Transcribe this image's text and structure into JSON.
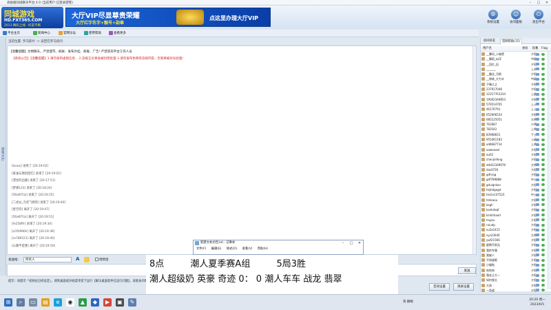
{
  "window": {
    "title": "高级版同城聊天平台 4.0 (当前用户:已登录游客)"
  },
  "banner": {
    "logo_title": "同城游戏",
    "logo_domain": "HD.FXT365.COM",
    "logo_slogan": "2013 精彩上线 · 好友不断",
    "ad_title": "大厅VIP尽显尊贵荣耀",
    "ad_sub": "大厅红字名字+靓号+勋章",
    "ad_action": "点这里办理大厅VIP"
  },
  "top_buttons": [
    {
      "label": "系统设置",
      "icon": "gear-icon"
    },
    {
      "label": "访问面板",
      "icon": "person-icon"
    },
    {
      "label": "退出平台",
      "icon": "exit-icon"
    }
  ],
  "toolbar": [
    {
      "label": "平台主页",
      "icon": "home-icon",
      "color": "#3b79c9"
    },
    {
      "label": "新闻中心",
      "icon": "news-icon",
      "color": "#4caf50"
    },
    {
      "label": "官网论坛",
      "icon": "forum-icon",
      "color": "#e6a23c"
    },
    {
      "label": "使用帮助",
      "icon": "help-icon",
      "color": "#2aa5a0"
    },
    {
      "label": "查看更多",
      "icon": "more-icon",
      "color": "#9b59b6"
    }
  ],
  "breadcrumb": "当前位置: 罗马影片 -> 返回在罗马房间",
  "side_tab": "游戏大厅",
  "notice": "【温馨提醒】文明聊天，严禁谩骂、刷屏、发布外挂、病毒、广告! 严禁冒充平台工作人员",
  "system_message": "【系统公告】【温馨提醒】1.请勿发布虚假信息... 2.违规言论将会被封禁处理 3.请勿发布色情等违规内容，否则将被封号处理!",
  "chat_lines": [
    "[koiuo] 进来了 [20:19:02]",
    "[爱油与我的回忆] 进来了 [20:19:02]",
    "[漂亮的出路] 进来了 [20:17:51]",
    "[梦想123] 进来了 [20:18:24]",
    "[56a6f7zz] 进来了 [20:19:25]",
    "[二虎伙_鸟老飞爬的] 进来了 [20:19:40]",
    "[星空的] 离开了 [20:19:47]",
    "[56a6f7zz] 离开了 [20:19:51]",
    "[fe258ffr] 进来了 [20:19:34]",
    "[a76t990h] 离开了 [20:19:39]",
    "[ss786521] 离开了 [20:19:40]",
    "[以路不是我] 离开了 [20:19:50]"
  ],
  "input": {
    "send_to_label": "发送给:",
    "send_to_value": "所有人",
    "private_label": "悄悄话",
    "send_button": "发送"
  },
  "bottom_tip": "提示：如提示「初始化已经设定」，请到桌面或开始菜单里下运行【解决桌面软件已运行问题】，或者关闭电脑重新启动软件即可",
  "bottom_buttons": [
    "音效设置",
    "清屏设置"
  ],
  "right_panel": {
    "tabs": [
      "房间好友",
      "官网帮助(35)"
    ],
    "headers": [
      "用户名",
      "身份",
      "形象",
      "Flag"
    ],
    "users": [
      {
        "name": "__暴风_小暗黑",
        "role": "夕阳"
      },
      {
        "name": "__舞蹈_似浮",
        "role": "中级"
      },
      {
        "name": "__回忆_旧",
        "role": "夕阳"
      },
      {
        "name": "_______",
        "role": "上升"
      },
      {
        "name": "__霸业_月帆",
        "role": "夕阳"
      },
      {
        "name": "__修炼_大力丰",
        "role": "中级"
      },
      {
        "name": "子晴儿之",
        "role": "夕阳"
      },
      {
        "name": "237917048",
        "role": "夕阳"
      },
      {
        "name": "12317761234",
        "role": "上级"
      },
      {
        "name": "19002349853",
        "role": "夕阳"
      },
      {
        "name": "576514765",
        "role": "上士"
      },
      {
        "name": "46176791",
        "role": "上士"
      },
      {
        "name": "652906524",
        "role": "夕阳"
      },
      {
        "name": "685125051",
        "role": "大将"
      },
      {
        "name": "763087",
        "role": "少将"
      },
      {
        "name": "783542",
        "role": "上将"
      },
      {
        "name": "83968831",
        "role": "下士"
      },
      {
        "name": "955461183",
        "role": "上级"
      },
      {
        "name": "a46687714",
        "role": "上将"
      },
      {
        "name": "aaweaaal",
        "role": "夕阳"
      },
      {
        "name": "au02",
        "role": "夕阳"
      },
      {
        "name": "chenjinfeng",
        "role": "夕阳"
      },
      {
        "name": "ddd12349678",
        "role": "大将"
      },
      {
        "name": "das0726",
        "role": "夕阳"
      },
      {
        "name": "gdhrag",
        "role": "夕阳"
      },
      {
        "name": "gdf789888",
        "role": "中士"
      },
      {
        "name": "gduiqnkan",
        "role": "夕阳"
      },
      {
        "name": "hejhdgagd",
        "role": "夕阳"
      },
      {
        "name": "hei2u147523",
        "role": "中士"
      },
      {
        "name": "hmkaou",
        "role": "夕阳"
      },
      {
        "name": "kogh",
        "role": "夕阳"
      },
      {
        "name": "kankdaqf",
        "role": "夕阳"
      },
      {
        "name": "kinkhhaad",
        "role": "夕阳"
      },
      {
        "name": "mujeu",
        "role": "夕阳"
      },
      {
        "name": "ruiudp",
        "role": "夕阳"
      },
      {
        "name": "su2a1415",
        "role": "夕阳"
      },
      {
        "name": "xys23040",
        "role": "大将"
      },
      {
        "name": "ywf21566",
        "role": "夕阳"
      },
      {
        "name": "星期不耐无",
        "role": "夕阳"
      },
      {
        "name": "我的专属",
        "role": "夕阳"
      },
      {
        "name": "我被人",
        "role": "夕阳"
      },
      {
        "name": "不知道呢",
        "role": "夕阳"
      },
      {
        "name": "小猫啦",
        "role": "夕阳"
      },
      {
        "name": "哈哈哈",
        "role": "夕阳"
      },
      {
        "name": "落花之大一",
        "role": "夕阳"
      },
      {
        "name": "如何我太",
        "role": "夕阳"
      },
      {
        "name": "大雨",
        "role": "夕阳"
      },
      {
        "name": "一剑诶",
        "role": "夕阳"
      }
    ]
  },
  "notepad": {
    "title": "新建文本文档.txt - 记事本",
    "menu": [
      "文件(F)",
      "编辑(E)",
      "格式(O)",
      "查看(V)",
      "帮助(H)"
    ]
  },
  "overlay": {
    "time": "8点",
    "event": "潮人夏季赛A组",
    "format": "5局3胜",
    "match": "潮人超级奶 英豪 奇迹 0：  0 潮人车车 战龙 翡翠"
  },
  "taskbar": {
    "tray_text": "英 稿晰",
    "time": "20:20 周一",
    "date": "2023/6/5"
  }
}
